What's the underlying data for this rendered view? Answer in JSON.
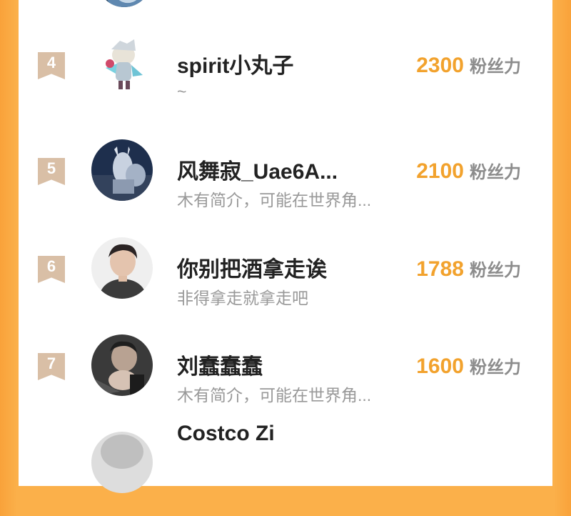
{
  "rows": [
    {
      "rank": "4",
      "name": "spirit小丸子",
      "bio": "~",
      "fans": "2300",
      "unit": "粉丝力"
    },
    {
      "rank": "5",
      "name": "风舞寂_Uae6A...",
      "bio": "木有简介，可能在世界角...",
      "fans": "2100",
      "unit": "粉丝力"
    },
    {
      "rank": "6",
      "name": "你别把酒拿走诶",
      "bio": "非得拿走就拿走吧",
      "fans": "1788",
      "unit": "粉丝力"
    },
    {
      "rank": "7",
      "name": "刘蠢蠢蠢",
      "bio": "木有简介，可能在世界角...",
      "fans": "1600",
      "unit": "粉丝力"
    },
    {
      "name": "Costco Zi"
    }
  ],
  "colors": {
    "background": "#fbb04a",
    "rank_badge": "#d9bfa6",
    "fans_number": "#f2a22d",
    "bio_text": "#999999"
  }
}
